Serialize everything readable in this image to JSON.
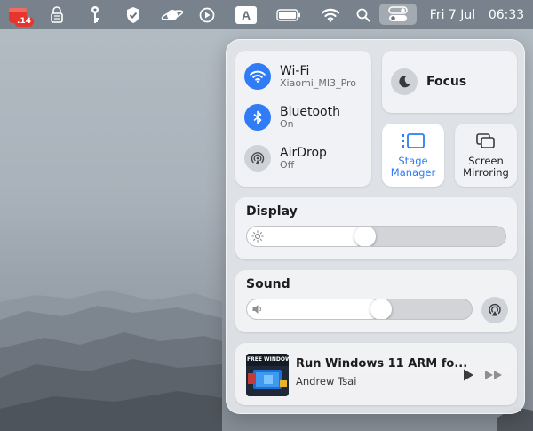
{
  "menubar": {
    "badge_count": ".14",
    "input_source_letter": "A",
    "date": "Fri 7 Jul",
    "time": "06:33"
  },
  "connectivity": {
    "wifi": {
      "title": "Wi-Fi",
      "subtitle": "Xiaomi_MI3_Pro",
      "state": "on"
    },
    "bluetooth": {
      "title": "Bluetooth",
      "subtitle": "On",
      "state": "on"
    },
    "airdrop": {
      "title": "AirDrop",
      "subtitle": "Off",
      "state": "off"
    }
  },
  "focus": {
    "label": "Focus"
  },
  "stage_manager": {
    "line1": "Stage",
    "line2": "Manager",
    "active": true
  },
  "screen_mirroring": {
    "line1": "Screen",
    "line2": "Mirroring"
  },
  "display": {
    "title": "Display",
    "level_percent": 45
  },
  "sound": {
    "title": "Sound",
    "level_percent": 60
  },
  "now_playing": {
    "title": "Run Windows 11 ARM fo...",
    "artist": "Andrew Tsai",
    "album_text": "FREE WINDOWS?"
  },
  "colors": {
    "accent": "#2f7cf6",
    "badge": "#e5352d"
  }
}
